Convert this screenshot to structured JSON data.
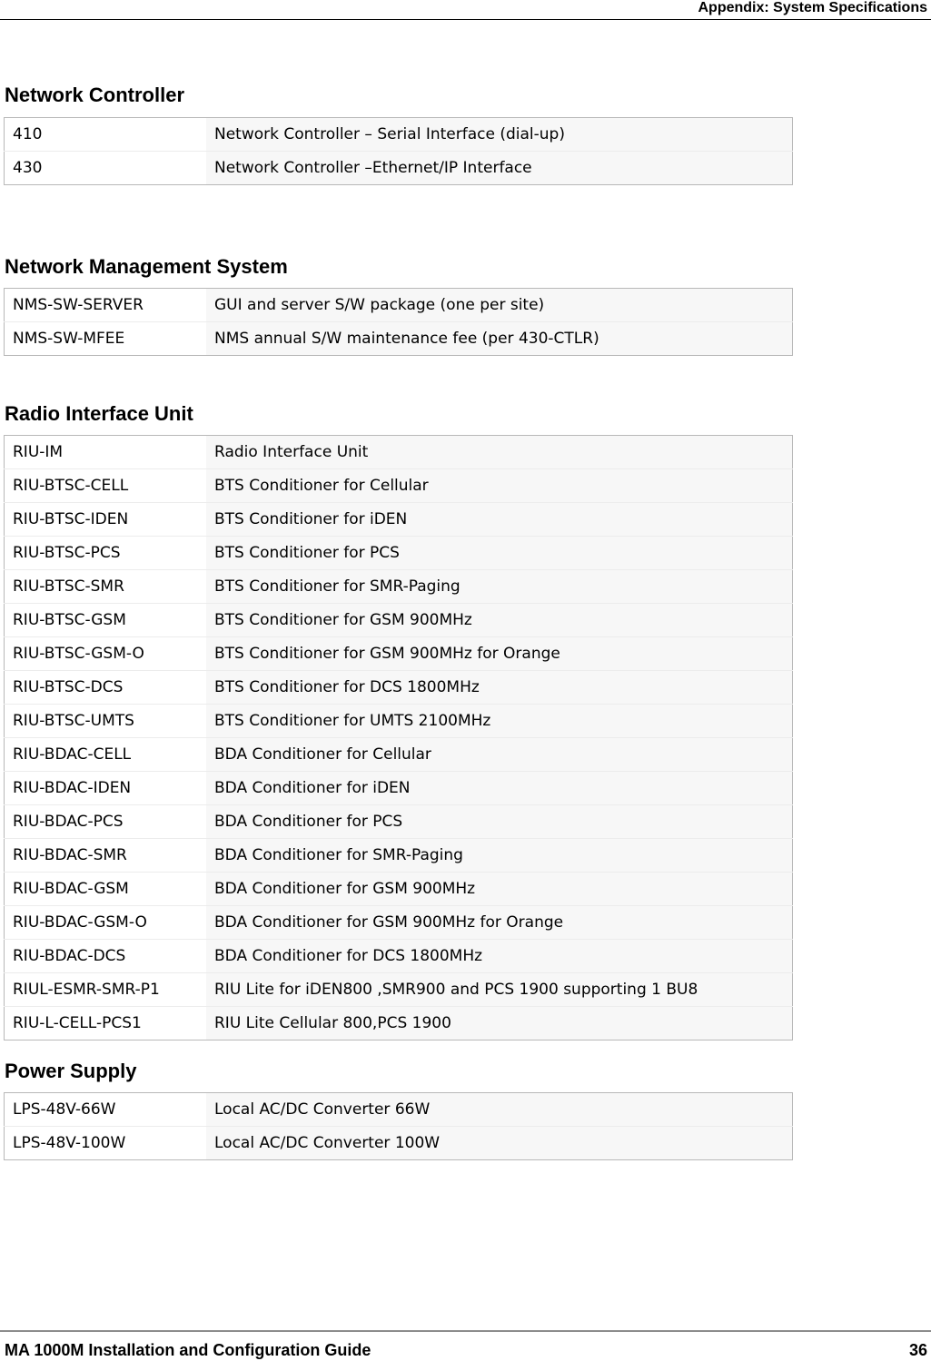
{
  "header": {
    "text": "Appendix: System Specifications"
  },
  "sections": [
    {
      "title": "Network Controller",
      "rows": [
        {
          "code": "410",
          "desc": "Network Controller – Serial Interface (dial-up)"
        },
        {
          "code": "430",
          "desc": "Network Controller –Ethernet/IP Interface"
        }
      ]
    },
    {
      "title": "Network Management System",
      "rows": [
        {
          "code": "NMS-SW-SERVER",
          "desc": "GUI  and server S/W package (one per site)"
        },
        {
          "code": "NMS-SW-MFEE",
          "desc": "NMS annual S/W maintenance fee (per 430-CTLR)"
        }
      ]
    },
    {
      "title": "Radio Interface Unit",
      "rows": [
        {
          "code": "RIU-IM",
          "desc": "Radio Interface Unit"
        },
        {
          "code": "RIU-BTSC-CELL",
          "desc": "BTS Conditioner for Cellular"
        },
        {
          "code": "RIU-BTSC-IDEN",
          "desc": "BTS Conditioner for iDEN"
        },
        {
          "code": "RIU-BTSC-PCS",
          "desc": "BTS Conditioner for PCS"
        },
        {
          "code": "RIU-BTSC-SMR",
          "desc": "BTS Conditioner for SMR-Paging"
        },
        {
          "code": "RIU-BTSC-GSM",
          "desc": "BTS Conditioner for GSM 900MHz"
        },
        {
          "code": "RIU-BTSC-GSM-O",
          "desc": "BTS Conditioner for GSM 900MHz for Orange"
        },
        {
          "code": "RIU-BTSC-DCS",
          "desc": "BTS Conditioner for DCS 1800MHz"
        },
        {
          "code": "RIU-BTSC-UMTS",
          "desc": "BTS Conditioner for UMTS 2100MHz"
        },
        {
          "code": "RIU-BDAC-CELL",
          "desc": "BDA Conditioner for Cellular"
        },
        {
          "code": "RIU-BDAC-IDEN",
          "desc": "BDA Conditioner for iDEN"
        },
        {
          "code": "RIU-BDAC-PCS",
          "desc": "BDA Conditioner for PCS"
        },
        {
          "code": "RIU-BDAC-SMR",
          "desc": "BDA Conditioner for SMR-Paging"
        },
        {
          "code": "RIU-BDAC-GSM",
          "desc": "BDA Conditioner for GSM 900MHz"
        },
        {
          "code": "RIU-BDAC-GSM-O",
          "desc": "BDA Conditioner for GSM 900MHz for Orange"
        },
        {
          "code": "RIU-BDAC-DCS",
          "desc": "BDA Conditioner for DCS 1800MHz"
        },
        {
          "code": "RIUL-ESMR-SMR-P1",
          "desc": "RIU Lite for iDEN800 ,SMR900  and PCS 1900 supporting 1 BU8"
        },
        {
          "code": "RIU-L-CELL-PCS1",
          "desc": "RIU Lite Cellular 800,PCS 1900"
        }
      ]
    },
    {
      "title": "Power Supply",
      "rows": [
        {
          "code": "LPS-48V-66W",
          "desc": "Local AC/DC Converter 66W"
        },
        {
          "code": "LPS-48V-100W",
          "desc": "Local AC/DC Converter 100W"
        }
      ]
    }
  ],
  "footer": {
    "title": "MA 1000M Installation and Configuration Guide",
    "page_number": "36"
  }
}
